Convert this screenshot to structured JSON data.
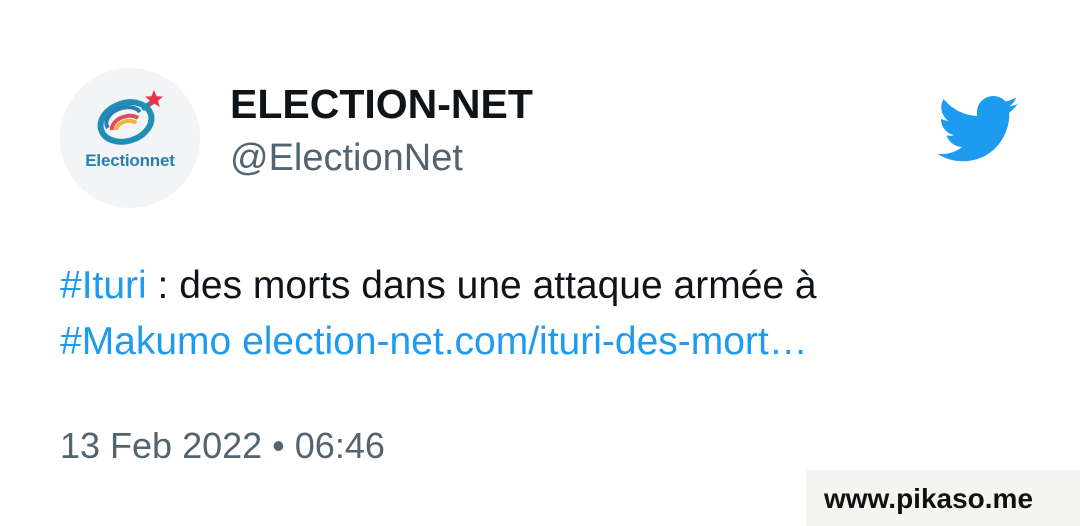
{
  "account": {
    "display_name": "ELECTION-NET",
    "handle": "@ElectionNet",
    "avatar_label": "Electionnet"
  },
  "tweet": {
    "hashtag_1": "#Ituri",
    "text_1": " : des morts dans une attaque armée à",
    "hashtag_2": "#Makumo",
    "link": "election-net.com/ituri-des-mort…",
    "timestamp": "13 Feb 2022 • 06:46"
  },
  "watermark": {
    "text": "www.pikaso.me"
  },
  "icons": {
    "platform": "twitter-bird-icon",
    "avatar_logo": "electionnet-logo"
  },
  "colors": {
    "link": "#1d9bf0",
    "twitter_blue": "#1d9bf0",
    "secondary_text": "#536471",
    "primary_text": "#0f1419"
  }
}
